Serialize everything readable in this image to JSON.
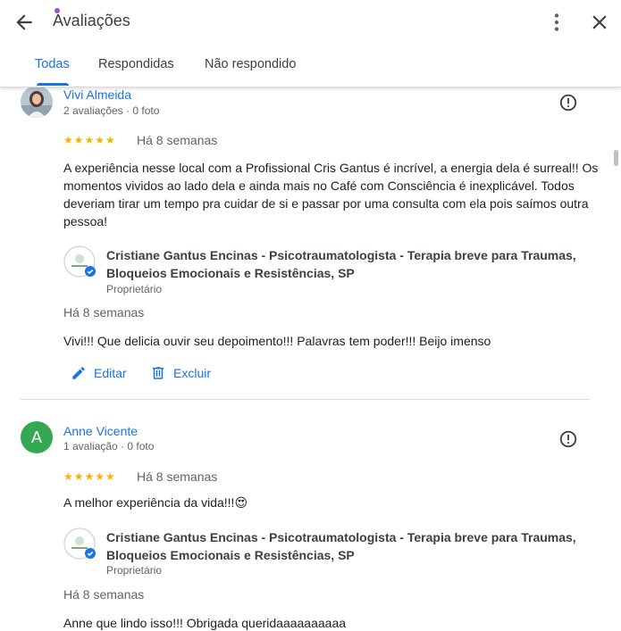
{
  "header": {
    "title": "Avaliações",
    "tabs": [
      {
        "label": "Todas",
        "active": true
      },
      {
        "label": "Respondidas",
        "active": false
      },
      {
        "label": "Não respondido",
        "active": false
      }
    ]
  },
  "colors": {
    "accent": "#1a73e8",
    "star": "#f4b400",
    "avatar_green": "#34a853"
  },
  "reviews": [
    {
      "name": "Vivi Almeida",
      "meta": "2 avaliações · 0 foto",
      "rating": 5,
      "stars": "★★★★★",
      "when": "Há 8 semanas",
      "text": "A experiência nesse local com a Profissional Cris Gantus é incrível, a energia dela é surreal!! Os momentos vividos ao lado dela e ainda mais no Café com Consciência é inexplicável. Todos deveriam tirar um tempo pra cuidar de si e passar por uma consulta com ela pois saímos outra pessoa!",
      "owner_name": "Cristiane Gantus Encinas - Psicotraumatologista - Terapia breve para Traumas, Bloqueios Emocionais e Resistências, SP",
      "owner_role": "Proprietário",
      "reply_when": "Há 8 semanas",
      "reply_text": "Vivi!!! Que delicia ouvir seu depoimento!!! Palavras tem poder!!! Beijo imenso",
      "edit_label": "Editar",
      "delete_label": "Excluir"
    },
    {
      "name": "Anne Vicente",
      "avatar_letter": "A",
      "meta": "1 avaliação · 0 foto",
      "rating": 5,
      "stars": "★★★★★",
      "when": "Há 8 semanas",
      "text": "A melhor experiência da vida!!!😍",
      "owner_name": "Cristiane Gantus Encinas - Psicotraumatologista - Terapia breve para Traumas, Bloqueios Emocionais e Resistências, SP",
      "owner_role": "Proprietário",
      "reply_when": "Há 8 semanas",
      "reply_text": "Anne que lindo isso!!! Obrigada queridaaaaaaaaaa"
    }
  ]
}
